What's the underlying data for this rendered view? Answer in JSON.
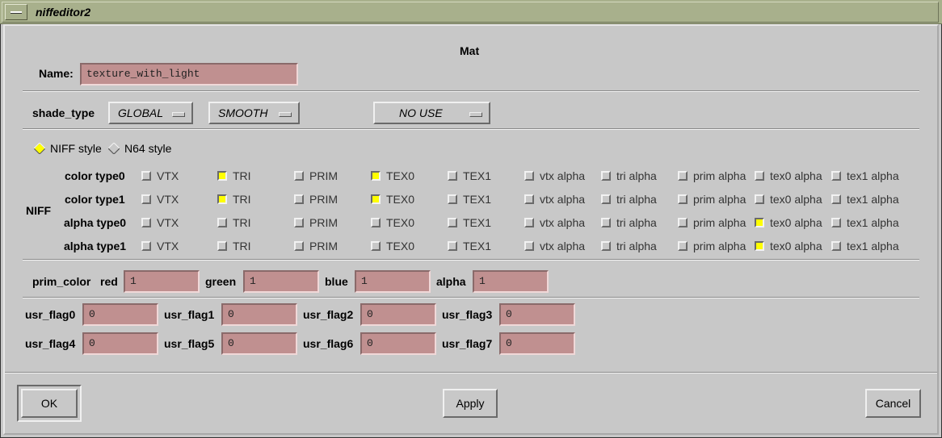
{
  "window": {
    "title": "niffeditor2"
  },
  "dialog_title": "Mat",
  "name": {
    "label": "Name:",
    "value": "texture_with_light"
  },
  "shade": {
    "label": "shade_type",
    "opt1": "GLOBAL",
    "opt2": "SMOOTH",
    "opt3": "NO USE"
  },
  "style": {
    "niff": "NIFF style",
    "n64": "N64 style",
    "selected": "NIFF style"
  },
  "niff": {
    "label": "NIFF",
    "columns": [
      "VTX",
      "TRI",
      "PRIM",
      "TEX0",
      "TEX1",
      "vtx alpha",
      "tri alpha",
      "prim alpha",
      "tex0 alpha",
      "tex1 alpha"
    ],
    "rows": [
      {
        "label": "color type0",
        "checked": [
          false,
          true,
          false,
          true,
          false,
          false,
          false,
          false,
          false,
          false
        ]
      },
      {
        "label": "color type1",
        "checked": [
          false,
          true,
          false,
          true,
          false,
          false,
          false,
          false,
          false,
          false
        ]
      },
      {
        "label": "alpha type0",
        "checked": [
          false,
          false,
          false,
          false,
          false,
          false,
          false,
          false,
          true,
          false
        ]
      },
      {
        "label": "alpha type1",
        "checked": [
          false,
          false,
          false,
          false,
          false,
          false,
          false,
          false,
          true,
          false
        ]
      }
    ]
  },
  "prim_color": {
    "label": "prim_color",
    "red_label": "red",
    "red": "1",
    "green_label": "green",
    "green": "1",
    "blue_label": "blue",
    "blue": "1",
    "alpha_label": "alpha",
    "alpha": "1"
  },
  "usr_flags": [
    {
      "label": "usr_flag0",
      "value": "0"
    },
    {
      "label": "usr_flag1",
      "value": "0"
    },
    {
      "label": "usr_flag2",
      "value": "0"
    },
    {
      "label": "usr_flag3",
      "value": "0"
    },
    {
      "label": "usr_flag4",
      "value": "0"
    },
    {
      "label": "usr_flag5",
      "value": "0"
    },
    {
      "label": "usr_flag6",
      "value": "0"
    },
    {
      "label": "usr_flag7",
      "value": "0"
    }
  ],
  "buttons": {
    "ok": "OK",
    "apply": "Apply",
    "cancel": "Cancel"
  },
  "colors": {
    "background": "#c8c8c8",
    "titlebar": "#a8b08c",
    "field": "#c09090",
    "check_on": "#ffff00"
  }
}
